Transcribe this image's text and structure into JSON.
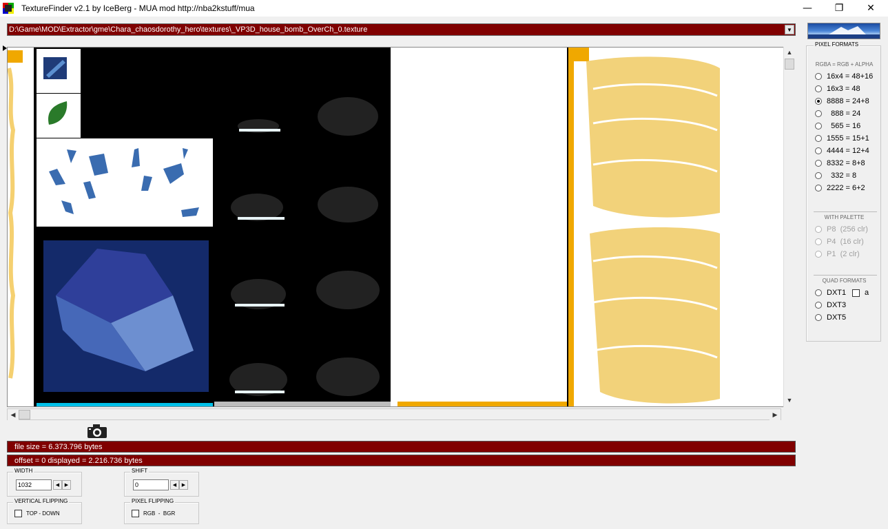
{
  "window": {
    "title": "TextureFinder v2.1 by IceBerg - MUA mod http://nba2kstuff/mua",
    "minimize": "—",
    "maximize": "❐",
    "close": "✕"
  },
  "path": {
    "value": "D:\\Game\\MOD\\Extractor\\gme\\Chara_chaosdorothy_hero\\textures\\_VP3D_house_bomb_OverCh_0.texture",
    "dropdown_glyph": "▼"
  },
  "status": {
    "file_size": "file size = 6.373.796 bytes",
    "offset": "offset = 0   displayed = 2.216.736 bytes"
  },
  "width_group": {
    "label": "WIDTH",
    "value": "1032"
  },
  "shift_group": {
    "label": "SHIFT",
    "value": "0"
  },
  "vflip_group": {
    "label": "VERTICAL FLIPPING",
    "option": "TOP - DOWN"
  },
  "pflip_group": {
    "label": "PIXEL FLIPPING",
    "option": "RGB  -  BGR"
  },
  "pixel_formats": {
    "title": "PIXEL FORMATS",
    "subtitle": "RGBA = RGB + ALPHA",
    "options": [
      {
        "label": "16x4 = 48+16",
        "selected": false
      },
      {
        "label": "16x3 = 48",
        "selected": false
      },
      {
        "label": "8888 = 24+8",
        "selected": true
      },
      {
        "label": "  888 = 24",
        "selected": false
      },
      {
        "label": "  565 = 16",
        "selected": false
      },
      {
        "label": "1555 = 15+1",
        "selected": false
      },
      {
        "label": "4444 = 12+4",
        "selected": false
      },
      {
        "label": "8332 = 8+8",
        "selected": false
      },
      {
        "label": "  332 = 8",
        "selected": false
      },
      {
        "label": "2222 = 6+2",
        "selected": false
      }
    ],
    "palette_title": "WITH PALETTE",
    "palette_options": [
      "P8  (256 clr)",
      "P4  (16 clr)",
      "P1  (2 clr)"
    ],
    "quad_title": "QUAD FORMATS",
    "quad_options": [
      "DXT1",
      "DXT3",
      "DXT5"
    ],
    "dxt1_alpha_label": "a"
  },
  "colors": {
    "status_bg": "#800000",
    "accent_orange": "#f0a800",
    "cyan_bar": "#00c0e8"
  },
  "icons": [
    "app-icon",
    "camera-icon",
    "logo-image"
  ]
}
